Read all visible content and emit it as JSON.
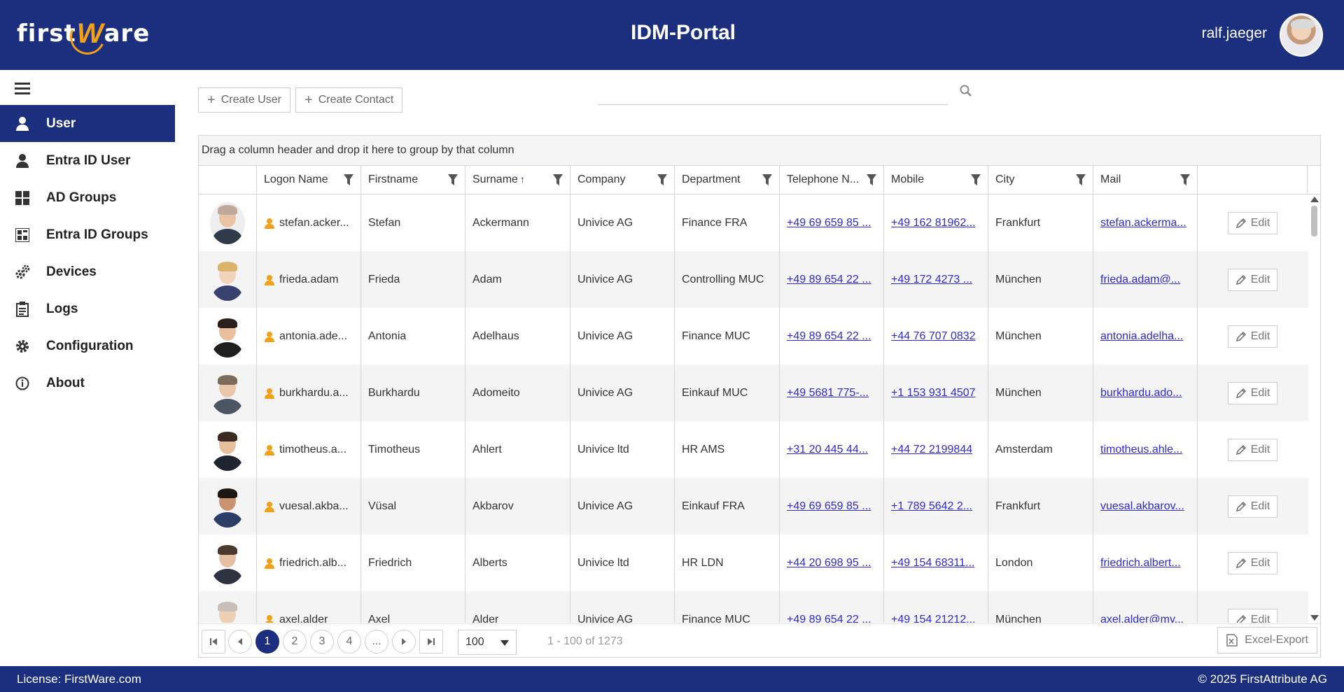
{
  "header": {
    "logo_first": "first",
    "logo_w": "W",
    "logo_are": "are",
    "title": "IDM-Portal",
    "username": "ralf.jaeger"
  },
  "sidebar": {
    "items": [
      {
        "label": "User",
        "icon": "user-icon",
        "active": true
      },
      {
        "label": "Entra ID User",
        "icon": "user-icon"
      },
      {
        "label": "AD Groups",
        "icon": "grid-icon"
      },
      {
        "label": "Entra ID Groups",
        "icon": "groups-icon"
      },
      {
        "label": "Devices",
        "icon": "devices-gears-icon"
      },
      {
        "label": "Logs",
        "icon": "clipboard-icon"
      },
      {
        "label": "Configuration",
        "icon": "gear-icon"
      },
      {
        "label": "About",
        "icon": "info-icon"
      }
    ]
  },
  "toolbar": {
    "create_user": "Create User",
    "create_contact": "Create Contact",
    "search_placeholder": ""
  },
  "grid": {
    "group_hint": "Drag a column header and drop it here to group by that column",
    "columns": [
      "",
      "Logon Name",
      "Firstname",
      "Surname",
      "Company",
      "Department",
      "Telephone N...",
      "Mobile",
      "City",
      "Mail",
      ""
    ],
    "sort_indicator": "↑",
    "edit_label": "Edit",
    "rows": [
      {
        "logon": "stefan.acker...",
        "first": "Stefan",
        "last": "Ackermann",
        "company": "Univice AG",
        "dept": "Finance FRA",
        "tel": "+49 69 659 85 ...",
        "mobile": "+49 162 81962...",
        "city": "Frankfurt",
        "mail": "stefan.ackerma..."
      },
      {
        "logon": "frieda.adam",
        "first": "Frieda",
        "last": "Adam",
        "company": "Univice AG",
        "dept": "Controlling MUC",
        "tel": "+49 89 654 22 ...",
        "mobile": "+49 172 4273 ...",
        "city": "München",
        "mail": "frieda.adam@..."
      },
      {
        "logon": "antonia.ade...",
        "first": "Antonia",
        "last": "Adelhaus",
        "company": "Univice AG",
        "dept": "Finance MUC",
        "tel": "+49 89 654 22 ...",
        "mobile": "+44 76 707 0832",
        "city": "München",
        "mail": "antonia.adelha..."
      },
      {
        "logon": "burkhardu.a...",
        "first": "Burkhardu",
        "last": "Adomeito",
        "company": "Univice AG",
        "dept": "Einkauf MUC",
        "tel": "+49 5681 775-...",
        "mobile": "+1 153 931 4507",
        "city": "München",
        "mail": "burkhardu.ado..."
      },
      {
        "logon": "timotheus.a...",
        "first": "Timotheus",
        "last": "Ahlert",
        "company": "Univice ltd",
        "dept": "HR AMS",
        "tel": "+31 20 445 44...",
        "mobile": "+44 72 2199844",
        "city": "Amsterdam",
        "mail": "timotheus.ahle..."
      },
      {
        "logon": "vuesal.akba...",
        "first": "Vüsal",
        "last": "Akbarov",
        "company": "Univice AG",
        "dept": "Einkauf FRA",
        "tel": "+49 69 659 85 ...",
        "mobile": "+1 789 5642 2...",
        "city": "Frankfurt",
        "mail": "vuesal.akbarov..."
      },
      {
        "logon": "friedrich.alb...",
        "first": "Friedrich",
        "last": "Alberts",
        "company": "Univice ltd",
        "dept": "HR LDN",
        "tel": "+44 20 698 95 ...",
        "mobile": "+49 154 68311...",
        "city": "London",
        "mail": "friedrich.albert..."
      },
      {
        "logon": "axel.alder",
        "first": "Axel",
        "last": "Alder",
        "company": "Univice AG",
        "dept": "Finance MUC",
        "tel": "+49 89 654 22 ...",
        "mobile": "+49 154 21212...",
        "city": "München",
        "mail": "axel.alder@my..."
      }
    ]
  },
  "pager": {
    "pages": [
      "1",
      "2",
      "3",
      "4",
      "..."
    ],
    "current": "1",
    "page_size": "100",
    "info": "1 - 100 of 1273",
    "excel": "Excel-Export"
  },
  "footer": {
    "license": "License: FirstWare.com",
    "copyright": "© 2025 FirstAttribute AG"
  },
  "colors": {
    "brand": "#1b2f7e",
    "accent": "#f1a01a",
    "link": "#2e2ad1"
  }
}
